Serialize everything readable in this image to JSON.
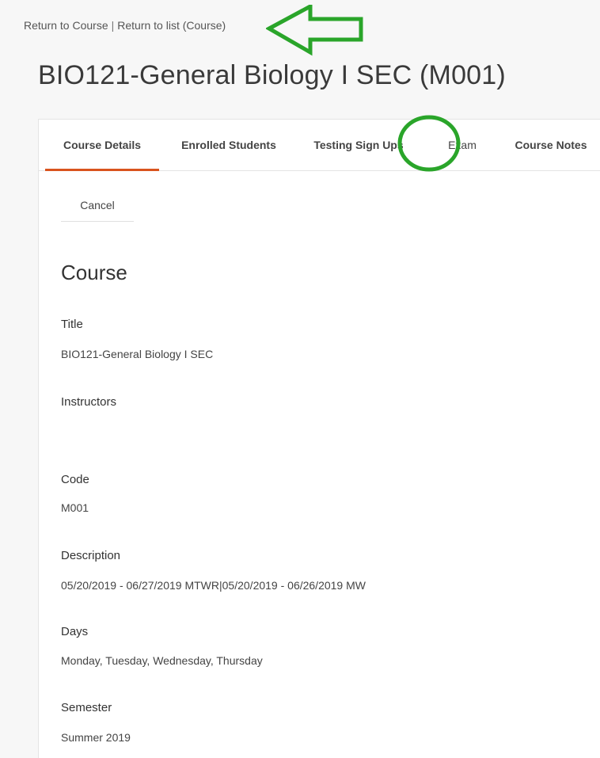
{
  "breadcrumb": {
    "return_course": "Return to Course",
    "separator": "|",
    "return_list": "Return to list (Course)"
  },
  "page_title": "BIO121-General Biology I SEC (M001)",
  "tabs": [
    {
      "label": "Course Details",
      "active": true
    },
    {
      "label": "Enrolled Students",
      "active": false
    },
    {
      "label": "Testing Sign Ups",
      "active": false
    },
    {
      "label": "Exam",
      "active": false
    },
    {
      "label": "Course Notes",
      "active": false
    }
  ],
  "actions": {
    "cancel_label": "Cancel"
  },
  "section_title": "Course",
  "fields": {
    "title": {
      "label": "Title",
      "value": "BIO121-General Biology I SEC"
    },
    "instructors": {
      "label": "Instructors",
      "value": ""
    },
    "code": {
      "label": "Code",
      "value": "M001"
    },
    "description": {
      "label": "Description",
      "value": "05/20/2019 - 06/27/2019 MTWR|05/20/2019 - 06/26/2019 MW"
    },
    "days": {
      "label": "Days",
      "value": "Monday, Tuesday, Wednesday, Thursday"
    },
    "semester": {
      "label": "Semester",
      "value": "Summer 2019"
    }
  },
  "colors": {
    "accent_underline": "#d9531e",
    "annotation_green": "#2aa52a"
  },
  "annotations": [
    {
      "type": "arrow",
      "points_to": "breadcrumb",
      "icon": "arrow-left-icon"
    },
    {
      "type": "circle",
      "highlights": "tab-exam",
      "icon": "circle-highlight-icon"
    }
  ]
}
